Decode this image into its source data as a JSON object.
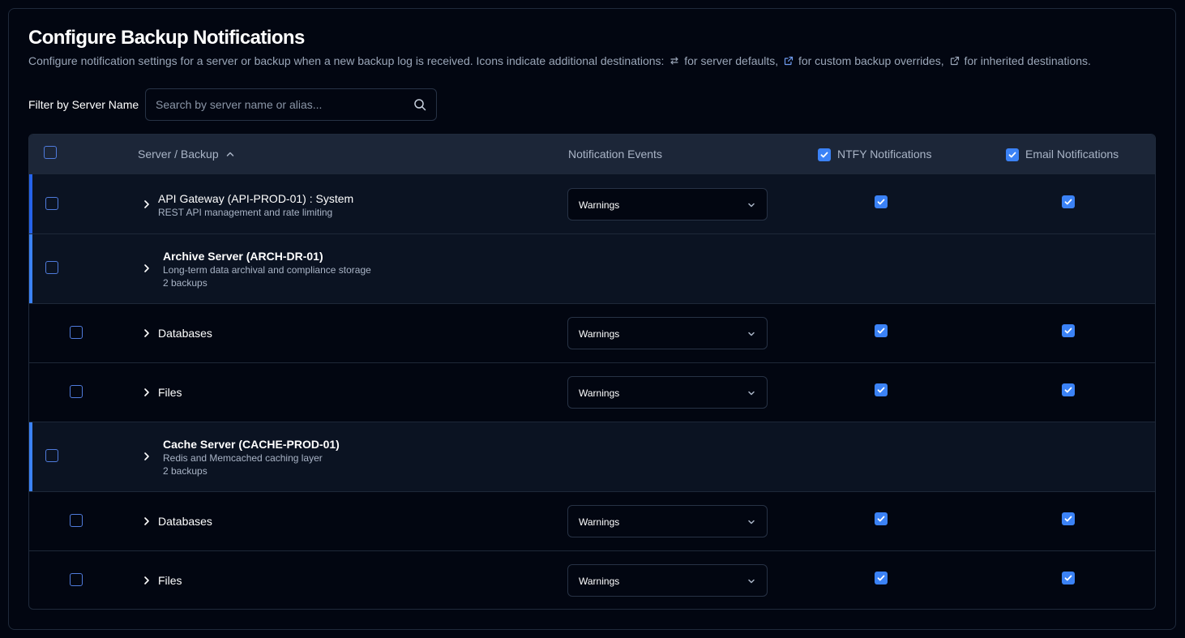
{
  "page": {
    "title": "Configure Backup Notifications",
    "description_parts": [
      "Configure notification settings for a server or backup when a new backup log is received. Icons indicate additional destinations: ",
      " for server defaults, ",
      " for custom backup overrides, ",
      " for inherited destinations."
    ]
  },
  "filter": {
    "label": "Filter by Server Name",
    "placeholder": "Search by server name or alias...",
    "value": ""
  },
  "table": {
    "headers": {
      "server_backup": "Server / Backup",
      "events": "Notification Events",
      "ntfy": "NTFY Notifications",
      "email": "Email Notifications"
    },
    "header_ntfy_checked": true,
    "header_email_checked": true,
    "sort": "ascending",
    "rows": [
      {
        "type": "server-inline",
        "name": "API Gateway (API-PROD-01) : System",
        "description": "REST API management and rate limiting",
        "event": "Warnings",
        "ntfy": true,
        "email": true
      },
      {
        "type": "server",
        "name": "Archive Server (ARCH-DR-01)",
        "description": "Long-term data archival and compliance storage",
        "backups": "2 backups"
      },
      {
        "type": "backup",
        "name": "Databases",
        "event": "Warnings",
        "ntfy": true,
        "email": true
      },
      {
        "type": "backup",
        "name": "Files",
        "event": "Warnings",
        "ntfy": true,
        "email": true
      },
      {
        "type": "server",
        "name": "Cache Server (CACHE-PROD-01)",
        "description": "Redis and Memcached caching layer",
        "backups": "2 backups"
      },
      {
        "type": "backup",
        "name": "Databases",
        "event": "Warnings",
        "ntfy": true,
        "email": true
      },
      {
        "type": "backup",
        "name": "Files",
        "event": "Warnings",
        "ntfy": true,
        "email": true
      }
    ]
  },
  "colors": {
    "accent": "#3b82f6",
    "server_bar": "#2563eb",
    "background": "#020611",
    "header_bg": "#1c2638"
  }
}
